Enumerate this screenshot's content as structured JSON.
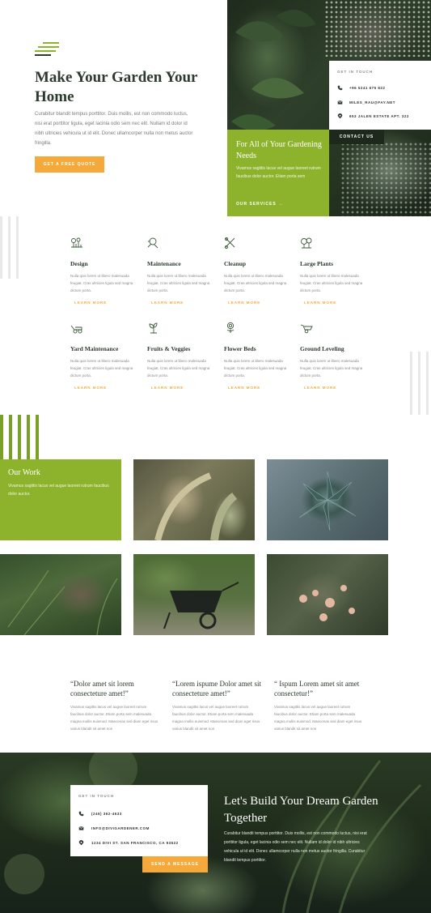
{
  "colors": {
    "accent_green": "#8db32c",
    "accent_orange": "#f6a93b",
    "dark_green": "#1d2a1b",
    "heading": "#2d3a2e"
  },
  "hero": {
    "title": "Make Your Garden Your Home",
    "text": "Curabitur blandit tempus porttitor. Duis mollis, est non commodo luctus, nisi erat porttitor ligula, eget lacinia odio sem nec elit. Nullam id dolor id nibh ultricies vehicula ut id elit. Donec ullamcorper nulla non metus auctor fringilla.",
    "button": "GET A FREE QUOTE"
  },
  "top_contact": {
    "title": "GET IN TOUCH",
    "phone": "+96 5241 675 822",
    "email": "MILES_RAU@FAY.NET",
    "address": "653 JALEN ESTATE APT. 322",
    "button": "CONTACT US"
  },
  "green_box": {
    "title": "For All of Your Gardening Needs",
    "text": "Vivamus sagittis lacus vel augue laoreet rutrum faucibus dolor auctor. Etiam porta sem",
    "link": "OUR SERVICES →"
  },
  "services": [
    {
      "icon": "garden-design-icon",
      "title": "Design",
      "text": "Nulla quis lorem ut libero malesuada feugiat. Cras ultricies ligula sed magna dictum porta.",
      "link": "LEARN MORE"
    },
    {
      "icon": "watering-can-icon",
      "title": "Maintenance",
      "text": "Nulla quis lorem ut libero malesuada feugiat. Cras ultricies ligula sed magna dictum porta.",
      "link": "LEARN MORE"
    },
    {
      "icon": "shears-icon",
      "title": "Cleanup",
      "text": "Nulla quis lorem ut libero malesuada feugiat. Cras ultricies ligula sed magna dictum porta.",
      "link": "LEARN MORE"
    },
    {
      "icon": "large-plants-icon",
      "title": "Large Plants",
      "text": "Nulla quis lorem ut libero malesuada feugiat. Cras ultricies ligula sed magna dictum porta.",
      "link": "LEARN MORE"
    },
    {
      "icon": "lawn-mower-icon",
      "title": "Yard Maintenance",
      "text": "Nulla quis lorem ut libero malesuada feugiat. Cras ultricies ligula sed magna dictum porta.",
      "link": "LEARN MORE"
    },
    {
      "icon": "sprout-icon",
      "title": "Fruits & Veggies",
      "text": "Nulla quis lorem ut libero malesuada feugiat. Cras ultricies ligula sed magna dictum porta.",
      "link": "LEARN MORE"
    },
    {
      "icon": "flower-icon",
      "title": "Flower Beds",
      "text": "Nulla quis lorem ut libero malesuada feugiat. Cras ultricies ligula sed magna dictum porta.",
      "link": "LEARN MORE"
    },
    {
      "icon": "wheelbarrow-icon",
      "title": "Ground Leveling",
      "text": "Nulla quis lorem ut libero malesuada feugiat. Cras ultricies ligula sed magna dictum porta.",
      "link": "LEARN MORE"
    }
  ],
  "work": {
    "title": "Our Work",
    "text": "Vivamus sagittis lacus vel augue laoreet rutrum faucibus dolor auctor."
  },
  "testimonials": [
    {
      "title": "“Dolor amet sit lorem consecteture amet!”",
      "text": "Vivamus sagittis lacus vel augue laoreet rutrum faucibus dolor auctor. Etiam porta sem malesuada magna mollis euismod. Maecenas sed diam eget risus varius blandit sit amet non"
    },
    {
      "title": "“Lorem ispume Dolor amet sit consecteture amet!”",
      "text": "Vivamus sagittis lacus vel augue laoreet rutrum faucibus dolor auctor. Etiam porta sem malesuada magna mollis euismod. Maecenas sed diam eget risus varius blandit sit amet non"
    },
    {
      "title": "“ Ispum Lorem amet sit amet consectetur!”",
      "text": "Vivamus sagittis lacus vel augue laoreet rutrum faucibus dolor auctor. Etiam porta sem malesuada magna mollis euismod. Maecenas sed diam eget risus varius blandit sit amet non"
    }
  ],
  "footer": {
    "card_title": "GET IN TOUCH",
    "phone": "(246) 362-4633",
    "email": "INFO@DIVIGARDENER.COM",
    "address": "1234 DIVI ST. SAN FRANCISCO, CA 93522",
    "button": "SEND A MESSAGE",
    "title": "Let's Build Your Dream Garden Together",
    "text": "Curabitur blandit tempus porttitor. Duis mollis, est non commodo luctus, nisi erat porttitor ligula, eget lacinia odio sem nec elit. Nullam id dolor id nibh ultricies vehicula ut id elit. Donec ullamcorper nulla non metus auctor fringilla. Curabitur blandit tempus porttitor."
  }
}
